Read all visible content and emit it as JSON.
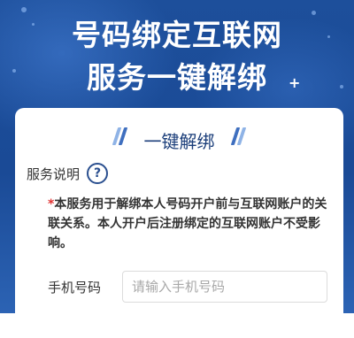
{
  "hero": {
    "title_line1": "号码绑定互联网",
    "title_line2": "服务一键解绑",
    "plus": "+"
  },
  "card": {
    "title": "一键解绑",
    "service_label": "服务说明",
    "help_icon": "?",
    "notice_star": "*",
    "notice_text": "本服务用于解绑本人号码开户前与互联网账户的关联关系。本人开户后注册绑定的互联网账户不受影响。",
    "phone_label": "手机号码",
    "phone_value": "",
    "phone_placeholder": "请输入手机号码"
  },
  "colors": {
    "hero_bg": "#1d4f9b",
    "card_title": "#1b3e7a",
    "notice_star": "#e03131",
    "help_icon": "#2a4f8f"
  }
}
